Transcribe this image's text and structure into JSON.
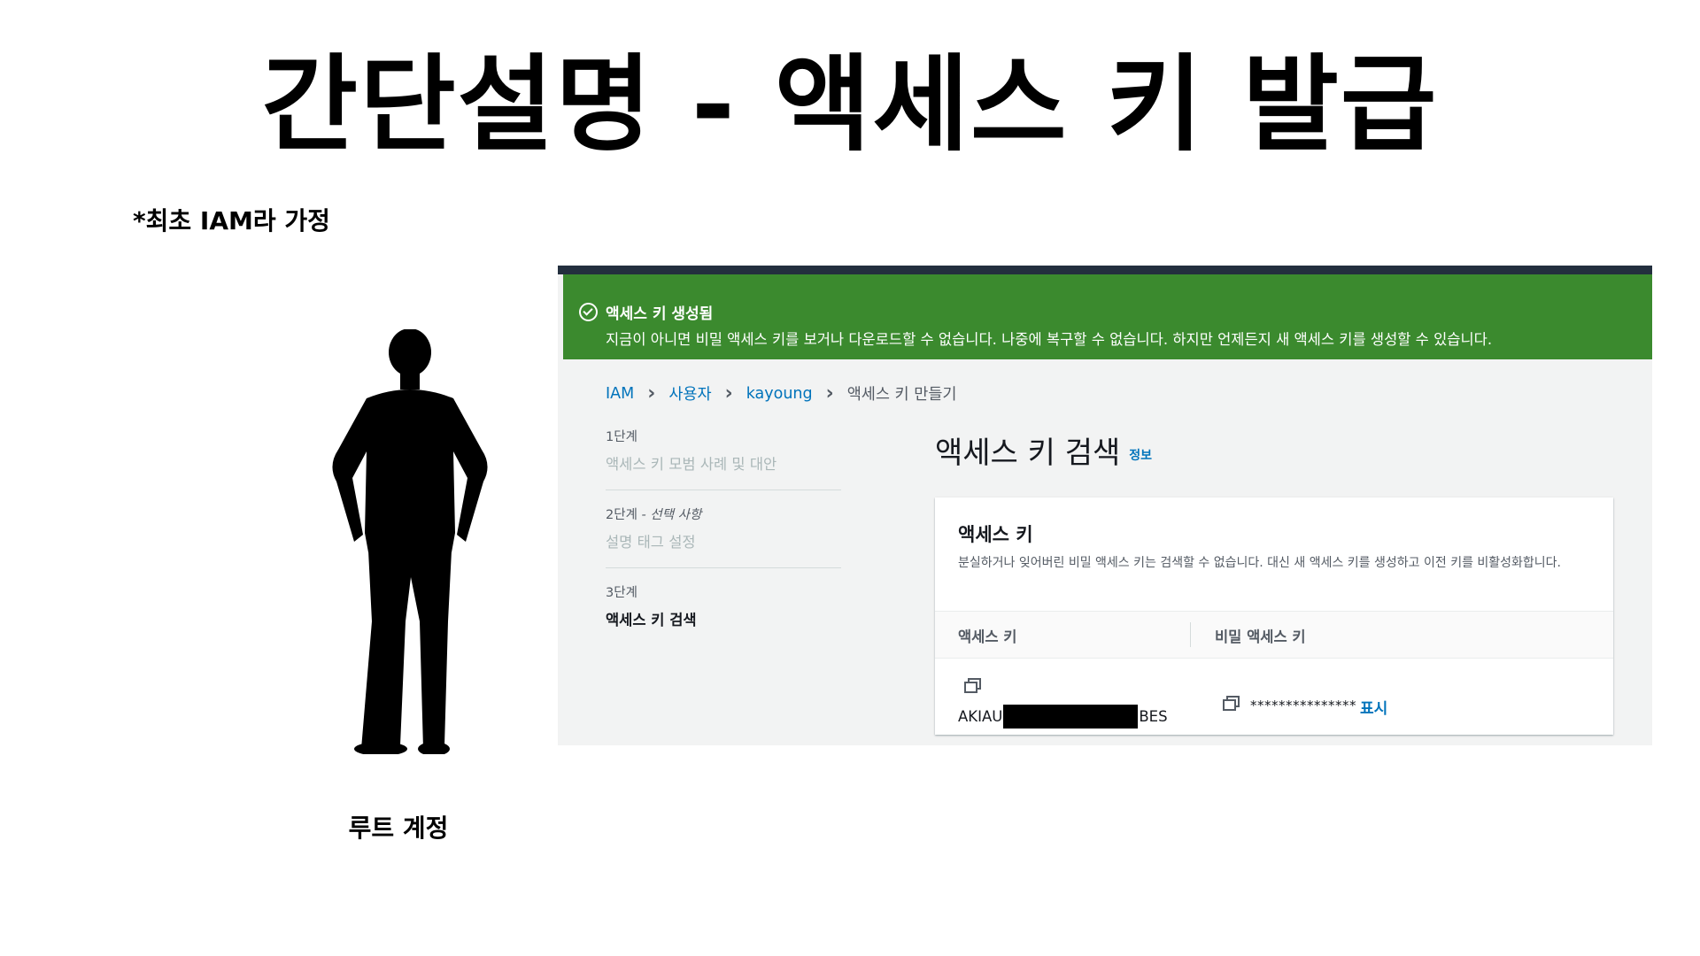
{
  "slide": {
    "title": "간단설명 - 액세스 키 발급",
    "assumption": "*최초 IAM라 가정",
    "person_caption": "루트 계정"
  },
  "console": {
    "flash": {
      "title": "액세스 키 생성됨",
      "message": "지금이 아니면 비밀 액세스 키를 보거나 다운로드할 수 없습니다. 나중에 복구할 수 없습니다. 하지만 언제든지 새 액세스 키를 생성할 수 있습니다."
    },
    "breadcrumb": [
      "IAM",
      "사용자",
      "kayoung",
      "액세스 키 만들기"
    ],
    "steps": [
      {
        "num": "1단계",
        "name": "액세스 키 모범 사례 및 대안"
      },
      {
        "num": "2단계",
        "optional": "- 선택 사항",
        "name": "설명 태그 설정"
      },
      {
        "num": "3단계",
        "name": "액세스 키 검색"
      }
    ],
    "page_title": "액세스 키 검색",
    "info_label": "정보",
    "card": {
      "title": "액세스 키",
      "description": "분실하거나 잊어버린 비밀 액세스 키는 검색할 수 없습니다. 대신 새 액세스 키를 생성하고 이전 키를 비활성화합니다.",
      "col_access_key": "액세스 키",
      "col_secret_key": "비밀 액세스 키",
      "access_key_prefix": "AKIAU",
      "access_key_suffix": "BES",
      "secret_masked": "***************",
      "show_label": "표시"
    }
  }
}
